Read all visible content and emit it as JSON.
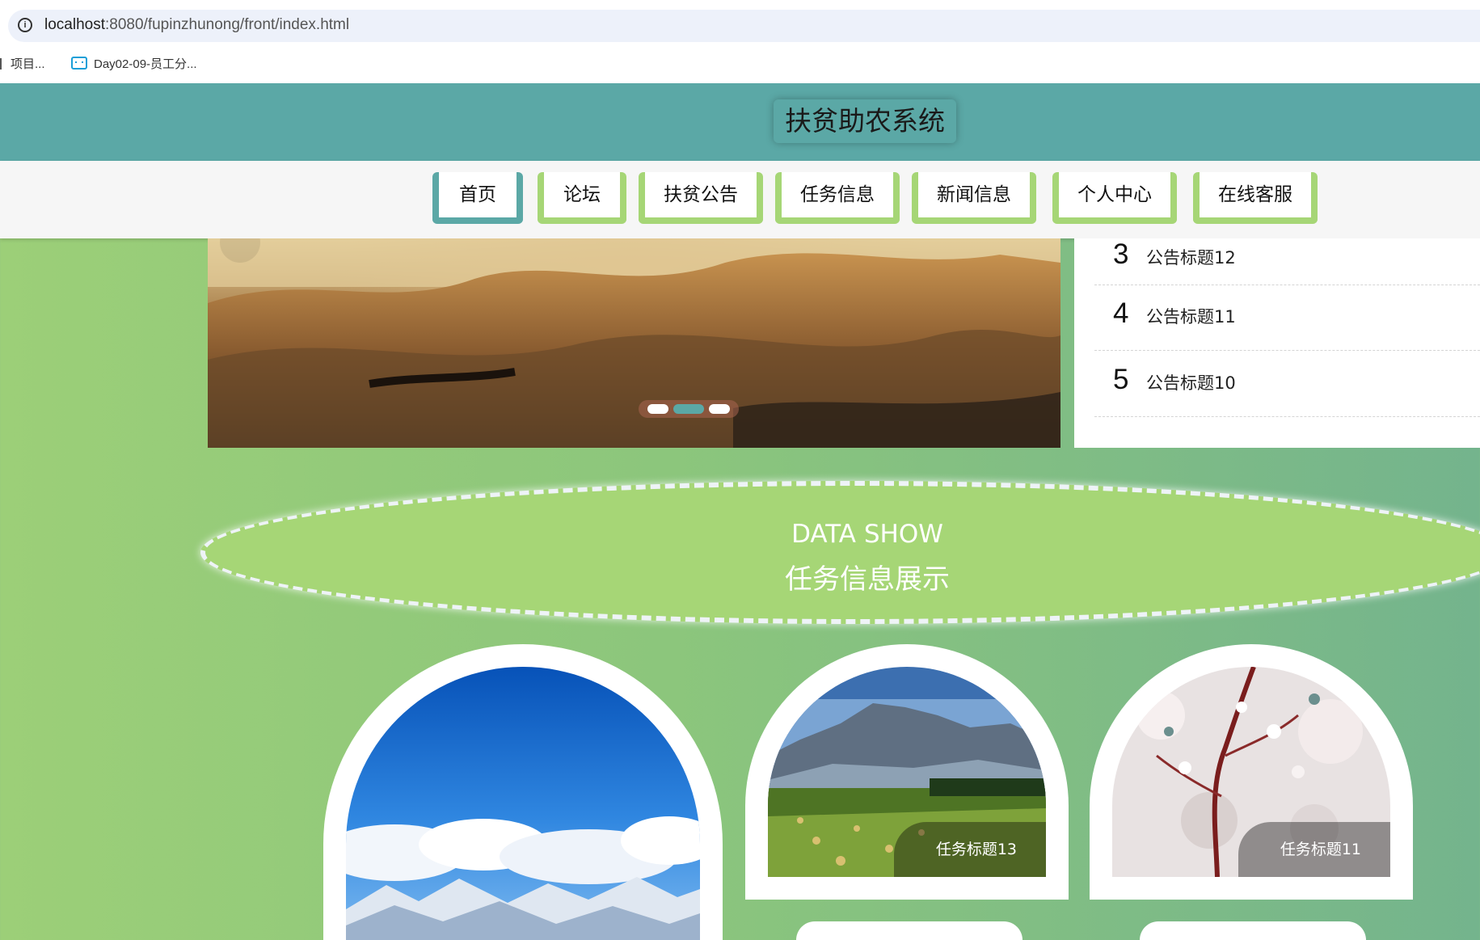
{
  "browser": {
    "url_host": "localhost",
    "url_rest": ":8080/fupinzhunong/front/index.html",
    "bookmarks": [
      {
        "label": "项目..."
      },
      {
        "label": "Day02-09-员工分..."
      }
    ],
    "icons": [
      "info-icon",
      "folder-icon",
      "bilibili-icon"
    ]
  },
  "header": {
    "title": "扶贫助农系统"
  },
  "nav": {
    "items": [
      {
        "label": "首页"
      },
      {
        "label": "论坛"
      },
      {
        "label": "扶贫公告"
      },
      {
        "label": "任务信息"
      },
      {
        "label": "新闻信息"
      },
      {
        "label": "个人中心"
      },
      {
        "label": "在线客服"
      }
    ],
    "active_index": 0
  },
  "banner": {
    "slide_count": 3,
    "active_slide": 1,
    "icons": [
      "chevron-left-icon"
    ]
  },
  "notices": [
    {
      "num": "3",
      "title": "公告标题12"
    },
    {
      "num": "4",
      "title": "公告标题11"
    },
    {
      "num": "5",
      "title": "公告标题10"
    }
  ],
  "section": {
    "en": "DATA SHOW",
    "cn": "任务信息展示"
  },
  "cards": [
    {
      "caption": "",
      "scene": "sky-snow-mountains"
    },
    {
      "caption": "任务标题13",
      "scene": "mountain-hay-field"
    },
    {
      "caption": "任务标题11",
      "scene": "cherry-blossom"
    }
  ],
  "colors": {
    "teal": "#5ba8a6",
    "light_green": "#a6d676",
    "bg_green_left": "#9ccf78",
    "bg_green_right": "#74b48d"
  }
}
